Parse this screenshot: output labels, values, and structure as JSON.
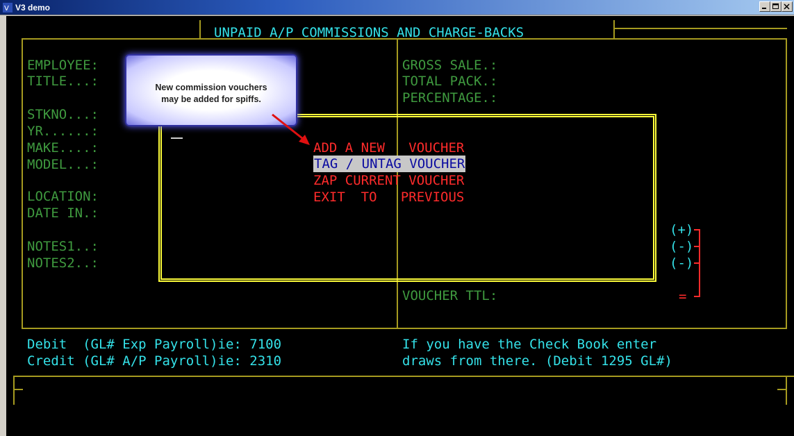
{
  "window": {
    "title": "V3 demo"
  },
  "screen": {
    "heading": "UNPAID A/P COMMISSIONS AND CHARGE-BACKS",
    "left_labels": [
      "EMPLOYEE:",
      "TITLE...:",
      "STKNO...:",
      "YR......:",
      "MAKE....:",
      "MODEL...:",
      "LOCATION:",
      "DATE IN.:",
      "NOTES1..:",
      "NOTES2..:"
    ],
    "right_labels": [
      "GROSS SALE.:",
      "TOTAL PACK.:",
      "PERCENTAGE.:"
    ],
    "voucher_total_label": "VOUCHER TTL:",
    "sign_markers": [
      "(+)",
      "(-)",
      "(-)",
      "="
    ],
    "gl_info": {
      "debit": "Debit  (GL# Exp Payroll)ie: 7100",
      "credit": "Credit (GL# A/P Payroll)ie: 2310",
      "checkbook_line1": "If you have the Check Book enter",
      "checkbook_line2": "draws from there. (Debit 1295 GL#)"
    }
  },
  "menu": {
    "items": [
      "ADD A NEW   VOUCHER",
      "TAG / UNTAG VOUCHER",
      "ZAP CURRENT VOUCHER",
      "EXIT  TO   PREVIOUS"
    ],
    "selected_index": 1
  },
  "callout": {
    "line1": "New commission vouchers",
    "line2": "may be added for spiffs."
  },
  "colors": {
    "label_green": "#3f9a3f",
    "text_cyan": "#34e1e8",
    "menu_red": "#ff2b2b",
    "border_olive": "#a69b20",
    "box_yellow": "#ffff3a"
  }
}
